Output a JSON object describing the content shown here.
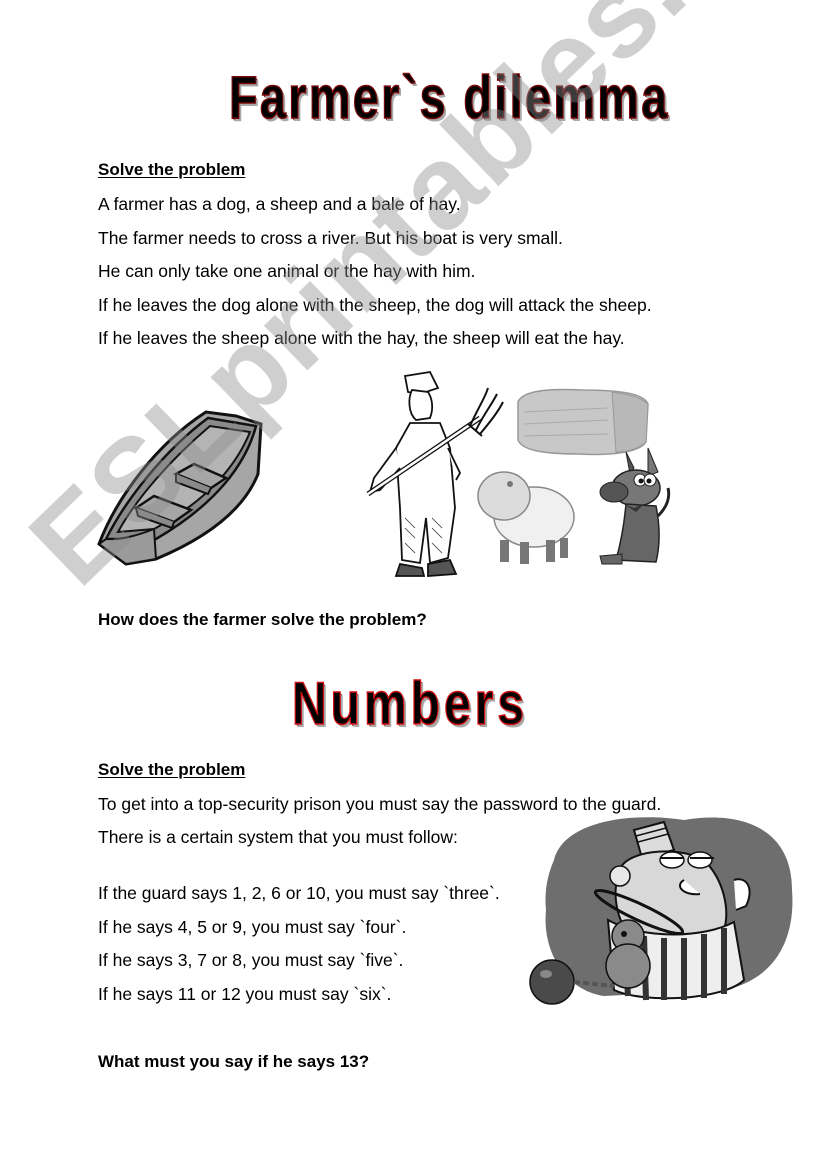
{
  "watermark": "ESLprintables.com",
  "section1": {
    "title": "Farmer`s dilemma",
    "heading": "Solve the problem",
    "lines": [
      "A farmer has a dog, a sheep and a bale of hay.",
      "The farmer needs to cross a river. But his boat is very small.",
      "He can only take one animal or the hay with him.",
      "If he leaves the dog alone with the sheep, the dog will attack the sheep.",
      "If he leaves the sheep alone with the hay, the sheep will eat the hay."
    ],
    "illustrations": [
      "rowing-boat",
      "farmer-with-pitchfork",
      "bale-of-hay",
      "sheep",
      "dog"
    ],
    "question": "How does the farmer solve the problem?"
  },
  "section2": {
    "title": "Numbers",
    "heading": "Solve the problem",
    "intro_lines": [
      "To get into a top-security prison you must say the password to the guard.",
      "There is a certain system that you must follow:"
    ],
    "rules": [
      "If the guard says 1, 2, 6 or 10, you must say `three`.",
      "If he says 4, 5 or 9, you must say `four`.",
      "If he says 3, 7 or 8, you must say `five`.",
      "If he says 11 or 12 you must say `six`."
    ],
    "illustrations": [
      "prisoner-with-teddy-bear-and-ball-and-chain"
    ],
    "question": "What must you say if he says 13?"
  },
  "colors": {
    "title1_outline": "#7a0a0a",
    "title2_outline": "#d01010",
    "text": "#000000",
    "watermark": "#8c8c8c"
  }
}
